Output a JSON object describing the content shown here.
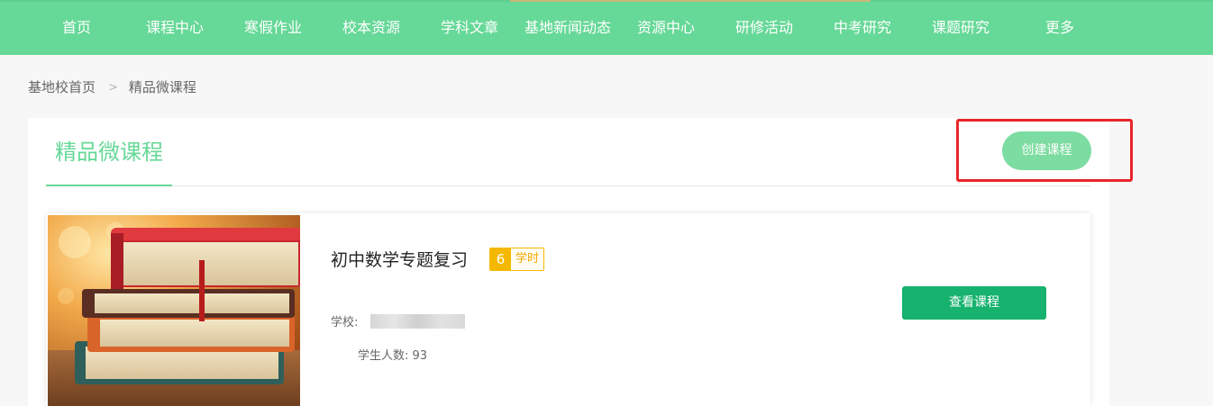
{
  "nav": {
    "items": [
      {
        "label": "首页"
      },
      {
        "label": "课程中心"
      },
      {
        "label": "寒假作业"
      },
      {
        "label": "校本资源"
      },
      {
        "label": "学科文章"
      },
      {
        "label": "基地新闻动态"
      },
      {
        "label": "资源中心"
      },
      {
        "label": "研修活动"
      },
      {
        "label": "中考研究"
      },
      {
        "label": "课题研究"
      },
      {
        "label": "更多"
      }
    ]
  },
  "breadcrumb": {
    "home": "基地校首页",
    "separator": ">",
    "current": "精品微课程"
  },
  "section": {
    "title": "精品微课程",
    "create_button": "创建课程"
  },
  "course": {
    "cover_icon": "books-stack-image",
    "title": "初中数学专题复习",
    "hours_value": "6",
    "hours_unit": "学时",
    "school_label": "学校:",
    "school_value": "",
    "students": "学生人数: 93",
    "view_button": "查看课程"
  },
  "colors": {
    "nav_background": "#66d897",
    "accent_green": "#66d897",
    "view_button": "#16b26e",
    "badge": "#f5b800",
    "highlight": "#e8262a"
  }
}
